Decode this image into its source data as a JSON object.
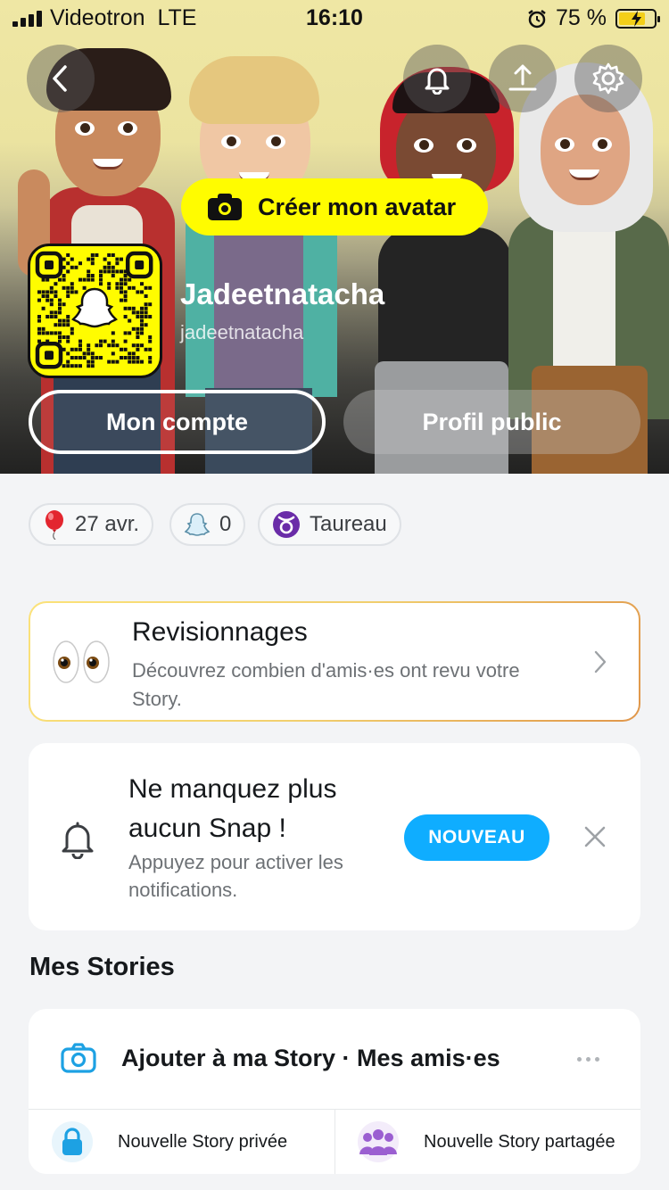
{
  "status_bar": {
    "carrier": "Videotron",
    "network": "LTE",
    "time": "16:10",
    "battery_percent": "75 %",
    "battery_level": 0.75,
    "icons": [
      "signal-icon",
      "alarm-icon",
      "battery-charging-icon"
    ]
  },
  "header": {
    "back_icon": "chevron-left-icon",
    "notification_icon": "bell-icon",
    "share_icon": "upload-icon",
    "settings_icon": "gear-icon"
  },
  "profile": {
    "create_avatar_label": "Créer mon avatar",
    "display_name": "Jadeetnatacha",
    "username": "jadeetnatacha",
    "account_button": "Mon compte",
    "public_profile_button": "Profil public"
  },
  "pills": [
    {
      "icon": "balloon-icon",
      "label": "27 avr."
    },
    {
      "icon": "snapscore-icon",
      "label": "0"
    },
    {
      "icon": "taurus-icon",
      "label": "Taureau"
    }
  ],
  "replays_card": {
    "icon": "eyes-icon",
    "title": "Revisionnages",
    "description": "Découvrez combien d'amis·es ont revu votre Story."
  },
  "notification_card": {
    "icon": "bell-icon",
    "title": "Ne manquez plus aucun Snap !",
    "description": "Appuyez pour activer les notifications.",
    "button": "NOUVEAU"
  },
  "stories": {
    "section_title": "Mes Stories",
    "add_label": "Ajouter à ma Story · Mes amis·es",
    "private_label": "Nouvelle Story privée",
    "shared_label": "Nouvelle Story partagée"
  },
  "colors": {
    "snap_yellow": "#fffc00",
    "accent_blue": "#0fadff",
    "camera_blue": "#1da1e3",
    "shared_purple": "#9b5fd1"
  }
}
